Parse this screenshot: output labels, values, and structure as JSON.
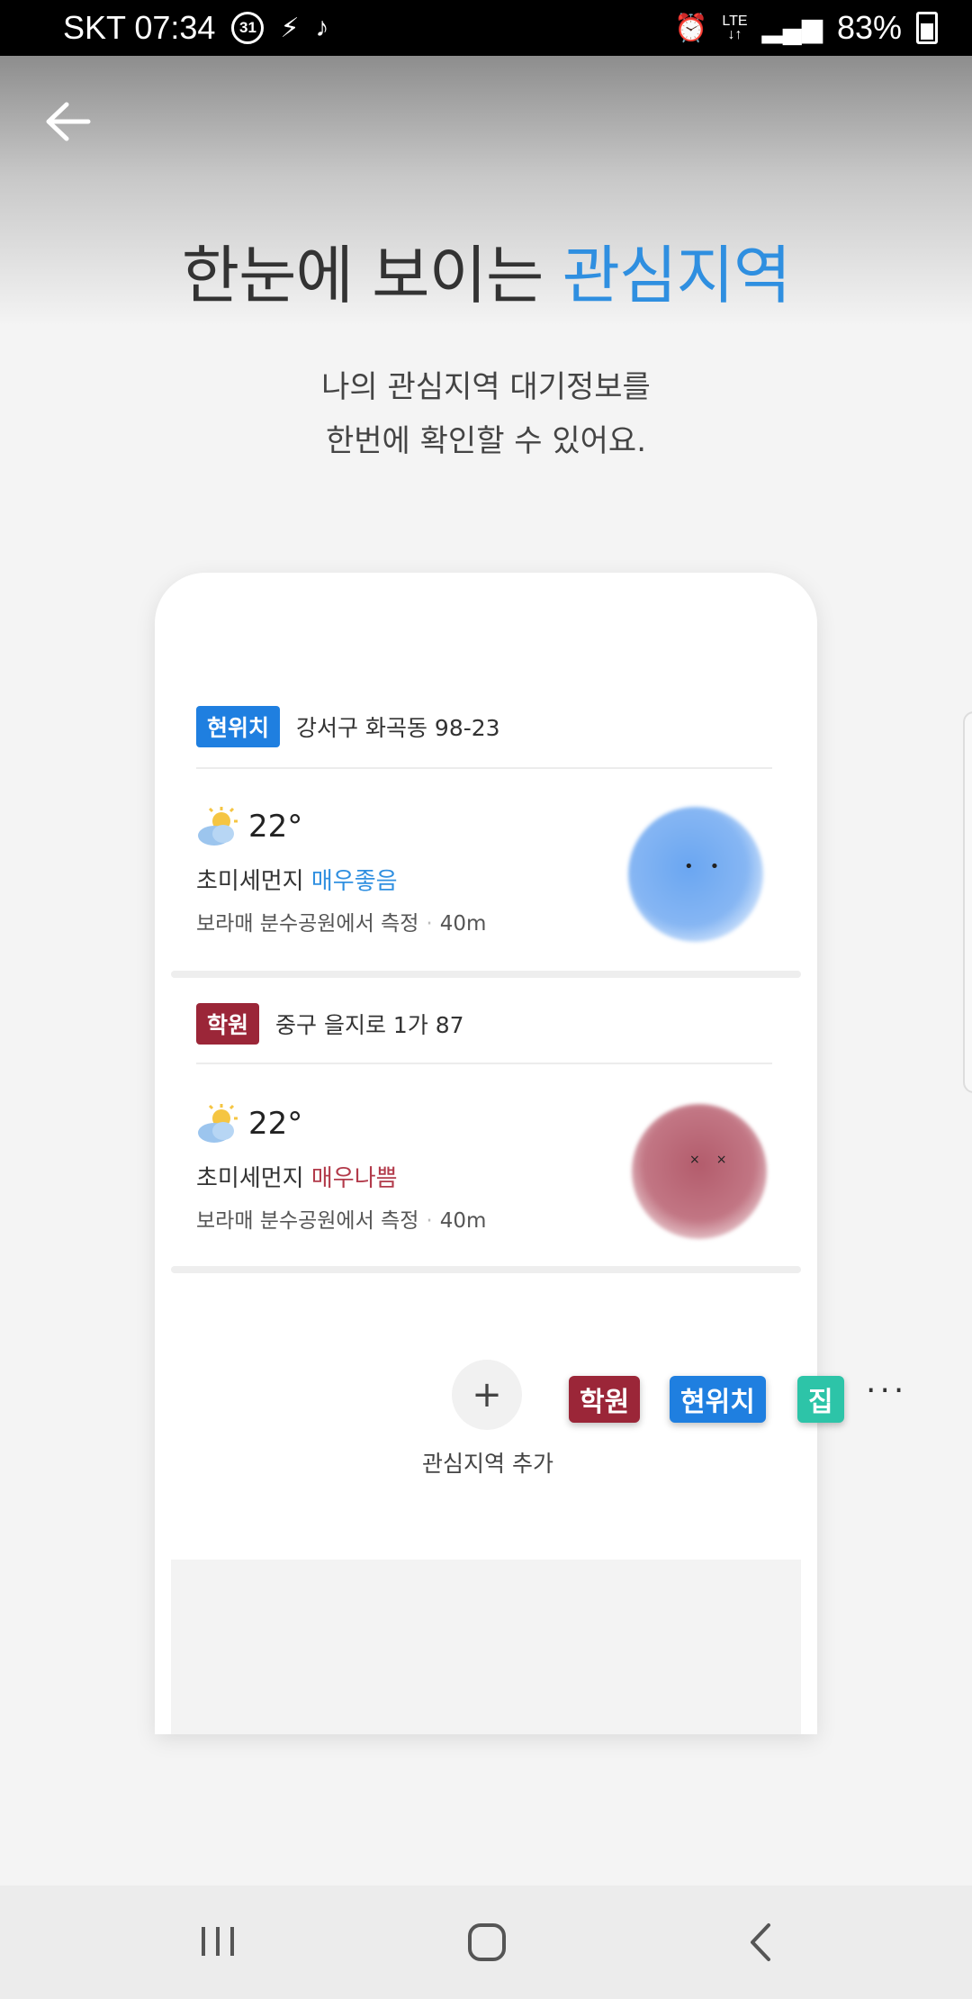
{
  "status_bar": {
    "carrier_time": "SKT 07:34",
    "calendar_badge": "31",
    "network": "LTE",
    "battery": "83%"
  },
  "header": {
    "title_main": "한눈에 보이는 ",
    "title_highlight": "관심지역",
    "subtitle_line1": "나의 관심지역 대기정보를",
    "subtitle_line2": "한번에 확인할 수 있어요."
  },
  "cards": [
    {
      "tag": "현위치",
      "address": "강서구 화곡동 98-23",
      "temp": "22°",
      "pm_label": "초미세먼지",
      "pm_status": "매우좋음",
      "station": "보라매 분수공원에서 측정",
      "distance": "40m"
    },
    {
      "tag": "학원",
      "address": "중구 을지로 1가 87",
      "temp": "22°",
      "pm_label": "초미세먼지",
      "pm_status": "매우나쁨",
      "station": "보라매 분수공원에서 측정",
      "distance": "40m"
    }
  ],
  "add_area": {
    "plus": "+",
    "label": "관심지역 추가"
  },
  "chips": {
    "academy": "학원",
    "current": "현위치",
    "home": "집",
    "more": "···"
  },
  "colors": {
    "accent_blue": "#2f8fe0",
    "tag_blue": "#1f7fe0",
    "tag_red": "#9b2638",
    "chip_teal": "#2dc4a8"
  }
}
